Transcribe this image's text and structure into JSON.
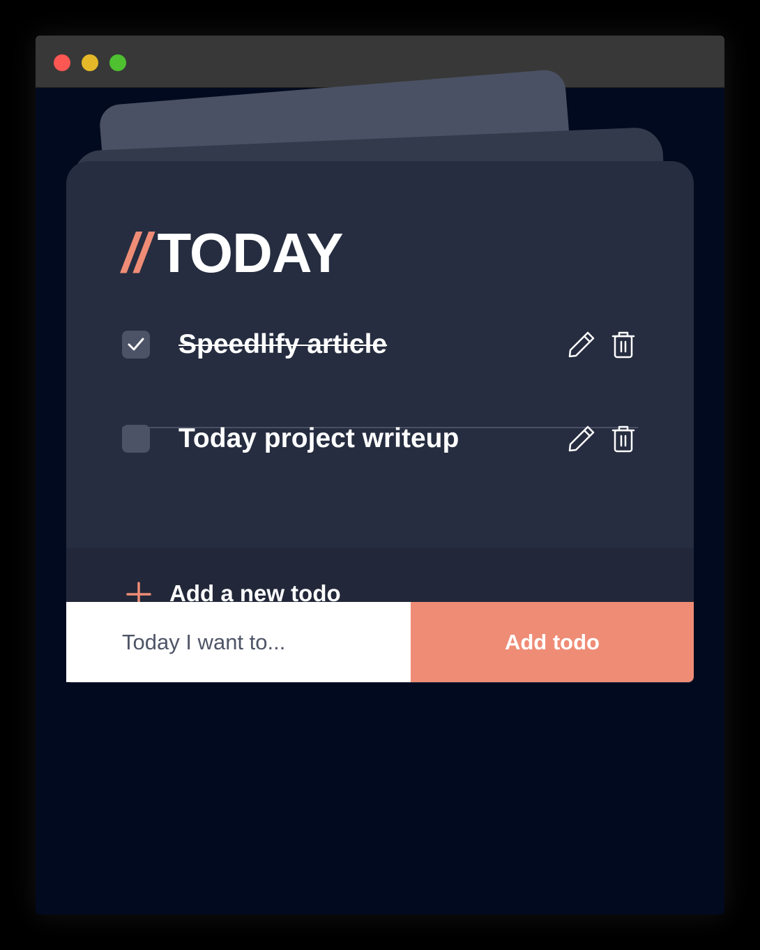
{
  "window": {
    "controls": [
      "close",
      "minimize",
      "zoom"
    ]
  },
  "colors": {
    "accent": "#ef8c76",
    "background": "#020a1f",
    "card": "#262d40",
    "titlebar": "#383838"
  },
  "header": {
    "prefix": "//",
    "title": "TODAY"
  },
  "todos": [
    {
      "label": "Speedlify article",
      "completed": true,
      "icons": [
        "edit-icon",
        "trash-icon"
      ]
    },
    {
      "label": "Today project writeup",
      "completed": false,
      "icons": [
        "edit-icon",
        "trash-icon"
      ]
    }
  ],
  "add": {
    "label": "Add a new todo",
    "icon": "plus-icon",
    "placeholder": "Today I want to...",
    "button_label": "Add todo"
  }
}
